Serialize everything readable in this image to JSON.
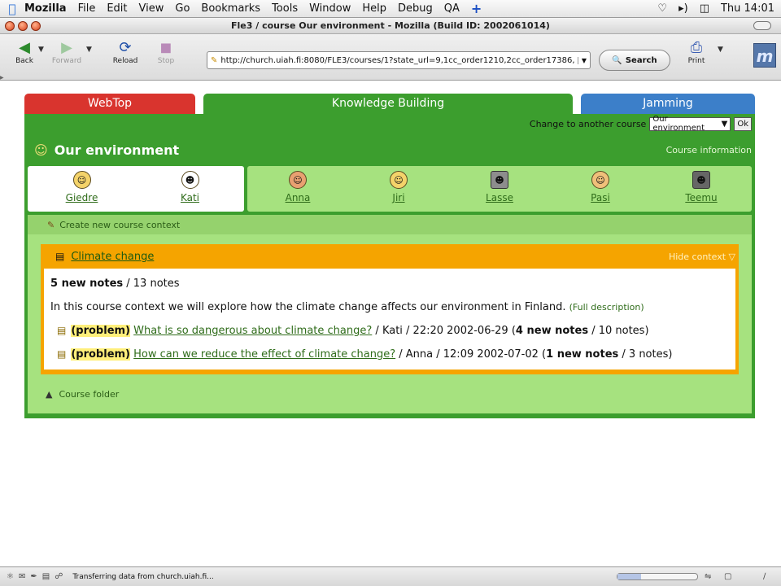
{
  "menubar": {
    "app": "Mozilla",
    "items": [
      "File",
      "Edit",
      "View",
      "Go",
      "Bookmarks",
      "Tools",
      "Window",
      "Help",
      "Debug",
      "QA"
    ],
    "clock": "Thu 14:01"
  },
  "window": {
    "title": "Fle3 / course Our environment - Mozilla (Build ID: 2002061014)"
  },
  "toolbar": {
    "back": "Back",
    "forward": "Forward",
    "reload": "Reload",
    "stop": "Stop",
    "url": "http://church.uiah.fi:8080/FLE3/courses/1?state_url=9,1cc_order1210,2cc_order17386,",
    "search": "Search",
    "print": "Print"
  },
  "tabs": {
    "webtop": "WebTop",
    "knowledge": "Knowledge Building",
    "jamming": "Jamming"
  },
  "course": {
    "change_label": "Change to another course",
    "selected": "Our environment",
    "ok": "Ok",
    "title": "Our environment",
    "info_link": "Course information"
  },
  "people": [
    {
      "name": "Giedre",
      "icon": "smiley-avatar-icon"
    },
    {
      "name": "Kati",
      "icon": "cartoon-face-icon"
    },
    {
      "name": "Anna",
      "icon": "girl-avatar-icon"
    },
    {
      "name": "Jiri",
      "icon": "smiley-avatar-icon"
    },
    {
      "name": "Lasse",
      "icon": "photo-avatar-icon"
    },
    {
      "name": "Pasi",
      "icon": "boy-avatar-icon"
    },
    {
      "name": "Teemu",
      "icon": "photo-avatar-icon"
    }
  ],
  "context": {
    "create_link": "Create new course context",
    "name": "Climate change",
    "hide": "Hide context",
    "new_notes": "5 new notes",
    "total_notes": " / 13 notes",
    "description": "In this course context we will explore how the climate change affects our environment in Finland.",
    "full_desc": "(Full description)",
    "notes": [
      {
        "kind": "(problem)",
        "title": "What is so dangerous about climate change?",
        "meta": " / Kati / 22:20 2002-06-29 ",
        "count_open": "(",
        "new": "4 new notes",
        "count_close": " / 10 notes)"
      },
      {
        "kind": "(problem)",
        "title": "How can we reduce the effect of climate change?",
        "meta": " / Anna / 12:09 2002-07-02 ",
        "count_open": "(",
        "new": "1 new notes",
        "count_close": " / 3 notes)"
      }
    ],
    "folder": "Course folder"
  },
  "status": {
    "message": "Transferring data from church.uiah.fi...",
    "progress": 0.3
  }
}
